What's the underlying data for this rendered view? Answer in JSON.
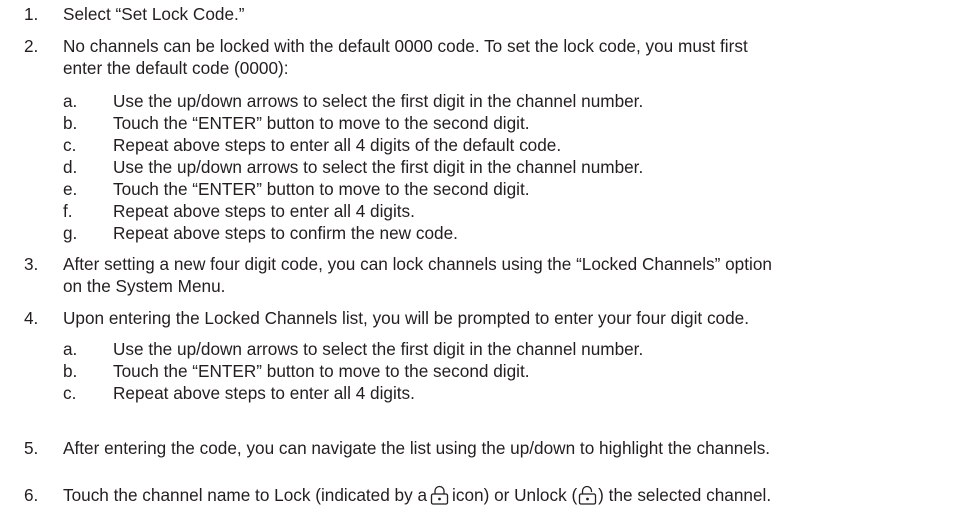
{
  "steps": [
    {
      "num": "1.",
      "lines": [
        "Select “Set Lock Code.”"
      ],
      "subs": []
    },
    {
      "num": "2.",
      "lines": [
        "No channels can be locked with the default 0000 code. To set the lock code, you must first",
        "enter the default code (0000):"
      ],
      "subs": [
        {
          "letter": "a.",
          "text": "Use the up/down arrows to select the first digit in the channel number."
        },
        {
          "letter": "b.",
          "text": "Touch the “ENTER” button to move to the second digit."
        },
        {
          "letter": "c.",
          "text": "Repeat above steps to enter all 4 digits of the default code."
        },
        {
          "letter": "d.",
          "text": "Use the up/down arrows to select the first digit in the channel number."
        },
        {
          "letter": "e.",
          "text": "Touch the “ENTER” button to move to the second digit."
        },
        {
          "letter": "f.",
          "text": "Repeat above steps to enter all 4 digits."
        },
        {
          "letter": "g.",
          "text": "Repeat above steps to confirm the new code."
        }
      ]
    },
    {
      "num": "3.",
      "lines": [
        "After setting a new four digit code, you can lock channels using the “Locked Channels” option",
        "on the System Menu."
      ],
      "subs": []
    },
    {
      "num": "4.",
      "lines": [
        "Upon entering the Locked Channels list, you will be prompted to enter your four digit code."
      ],
      "subs": [
        {
          "letter": "a.",
          "text": "Use the up/down arrows to select the first digit in the channel number."
        },
        {
          "letter": "b.",
          "text": "Touch the “ENTER” button to move to the second digit."
        },
        {
          "letter": "c.",
          "text": "Repeat above steps to enter all 4 digits."
        }
      ]
    },
    {
      "num": "5.",
      "lines": [
        "After entering the code, you can navigate the list using the up/down to highlight the channels."
      ],
      "subs": []
    },
    {
      "num": "6.",
      "text_parts": [
        "Touch the channel name to Lock (indicated by a",
        "icon) or Unlock (",
        ") the selected channel."
      ],
      "icons": [
        "locked-padlock-icon",
        "unlocked-padlock-icon"
      ]
    }
  ]
}
